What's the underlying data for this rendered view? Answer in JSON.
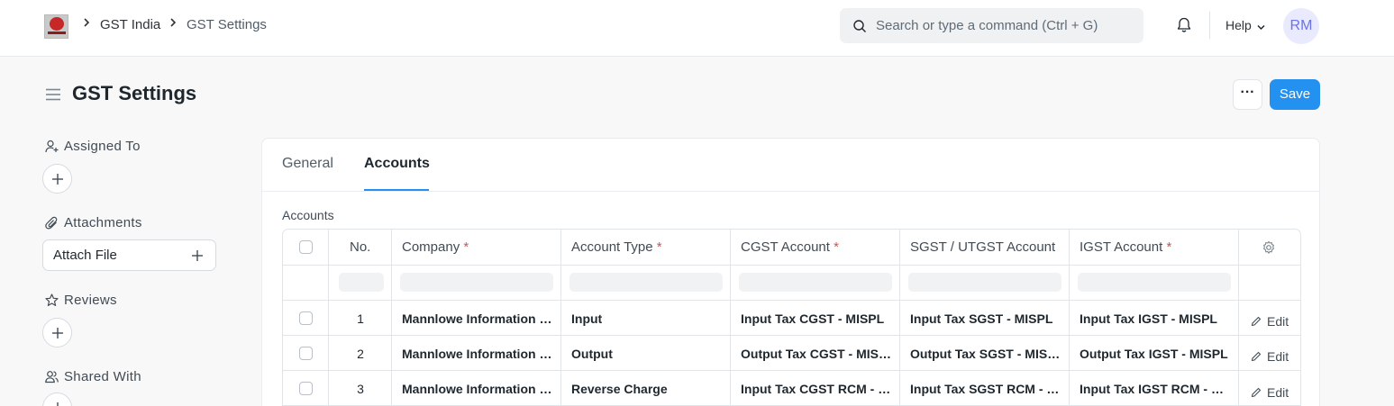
{
  "navbar": {
    "breadcrumbs": [
      "GST India",
      "GST Settings"
    ],
    "search_placeholder": "Search or type a command (Ctrl + G)",
    "help_label": "Help",
    "avatar_initials": "RM",
    "icons": [
      "app-logo",
      "chevron-right-icon",
      "search-icon",
      "bell-icon",
      "chevron-down-icon"
    ]
  },
  "page": {
    "title": "GST Settings",
    "more_label": "···",
    "save_label": "Save"
  },
  "sidebar": {
    "assigned_to": "Assigned To",
    "attachments": "Attachments",
    "attach_file": "Attach File",
    "reviews": "Reviews",
    "shared_with": "Shared With"
  },
  "tabs": [
    {
      "label": "General",
      "active": false
    },
    {
      "label": "Accounts",
      "active": true
    }
  ],
  "accounts": {
    "section_label": "Accounts",
    "columns": {
      "no": "No.",
      "company": "Company",
      "account_type": "Account Type",
      "cgst": "CGST Account",
      "sgst": "SGST / UTGST Account",
      "igst": "IGST Account",
      "required_mark": "*"
    },
    "edit_label": "Edit",
    "rows": [
      {
        "no": "1",
        "company": "Mannlowe Information Service Pvt Ltd",
        "account_type": "Input",
        "cgst": "Input Tax CGST - MISPL",
        "sgst": "Input Tax SGST - MISPL",
        "igst": "Input Tax IGST - MISPL"
      },
      {
        "no": "2",
        "company": "Mannlowe Information Service Pvt Ltd",
        "account_type": "Output",
        "cgst": "Output Tax CGST - MISPL",
        "sgst": "Output Tax SGST - MISPL",
        "igst": "Output Tax IGST - MISPL"
      },
      {
        "no": "3",
        "company": "Mannlowe Information Service Pvt Ltd",
        "account_type": "Reverse Charge",
        "cgst": "Input Tax CGST RCM - MISPL",
        "sgst": "Input Tax SGST RCM - MISPL",
        "igst": "Input Tax IGST RCM - MISPL"
      }
    ]
  },
  "colors": {
    "primary": "#2490ef",
    "required": "#e24c4c",
    "avatar_bg": "#e9eafd",
    "avatar_fg": "#6b73e5"
  }
}
